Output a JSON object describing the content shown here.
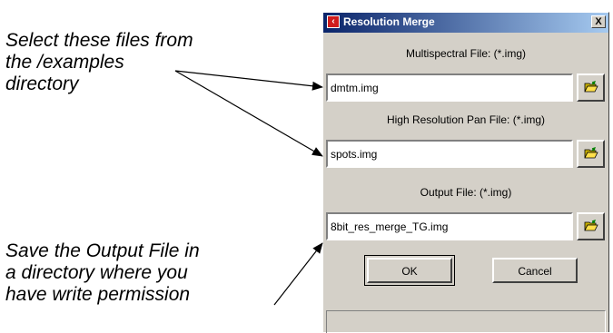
{
  "annotations": {
    "top_lines": [
      "Select these files from",
      "the /examples",
      "directory"
    ],
    "bottom_lines": [
      "Save the Output File in",
      "a directory where you",
      "have write permission"
    ]
  },
  "dialog": {
    "title": "Resolution Merge",
    "close_label": "X",
    "multispectral": {
      "label": "Multispectral File: (*.img)",
      "value": "dmtm.img"
    },
    "high_res": {
      "label": "High Resolution Pan File: (*.img)",
      "value": "spots.img"
    },
    "output": {
      "label": "Output File: (*.img)",
      "value": "8bit_res_merge_TG.img"
    },
    "ok_label": "OK",
    "cancel_label": "Cancel"
  },
  "icons": {
    "title_icon": "app-icon",
    "browse_icon": "folder-open-icon"
  }
}
